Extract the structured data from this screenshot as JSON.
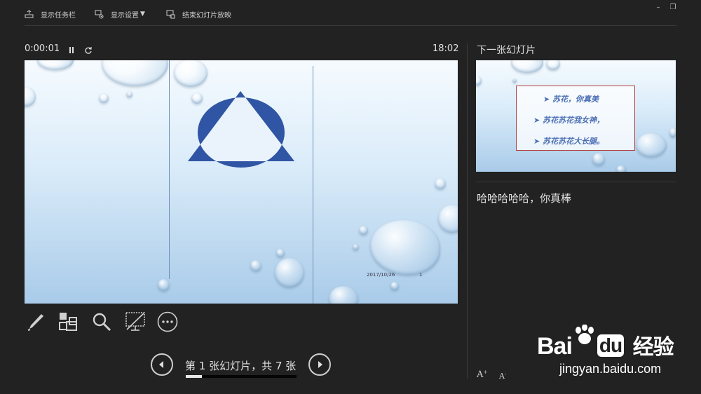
{
  "toolbar": {
    "show_taskbar": "显示任务栏",
    "display_settings": "显示设置",
    "display_settings_caret": "▼",
    "end_slideshow": "结束幻灯片放映"
  },
  "window": {
    "minimize": "–",
    "restore": "❐"
  },
  "timer": {
    "elapsed": "0:00:01",
    "clock": "18:02"
  },
  "current_slide": {
    "date": "2017/10/26",
    "number": "1"
  },
  "next_slide": {
    "label": "下一张幻灯片",
    "lines": [
      "苏花，你真美",
      "苏花苏花我女神，",
      "苏花苏花大长腿。"
    ]
  },
  "notes": {
    "text": "哈哈哈哈哈，你真棒"
  },
  "navigation": {
    "counter": "第 1 张幻灯片，共 7 张",
    "progress_fraction": 0.143
  },
  "font_controls": {
    "increase": "A",
    "decrease": "A"
  },
  "watermark": {
    "brand": "Bai",
    "brand2": "du",
    "cn": "经验",
    "url": "jingyan.baidu.com"
  },
  "colors": {
    "background": "#222222",
    "shape_blue": "#2f55a4",
    "slide_top": "#f6fbff",
    "slide_bottom": "#a9cbe9"
  }
}
